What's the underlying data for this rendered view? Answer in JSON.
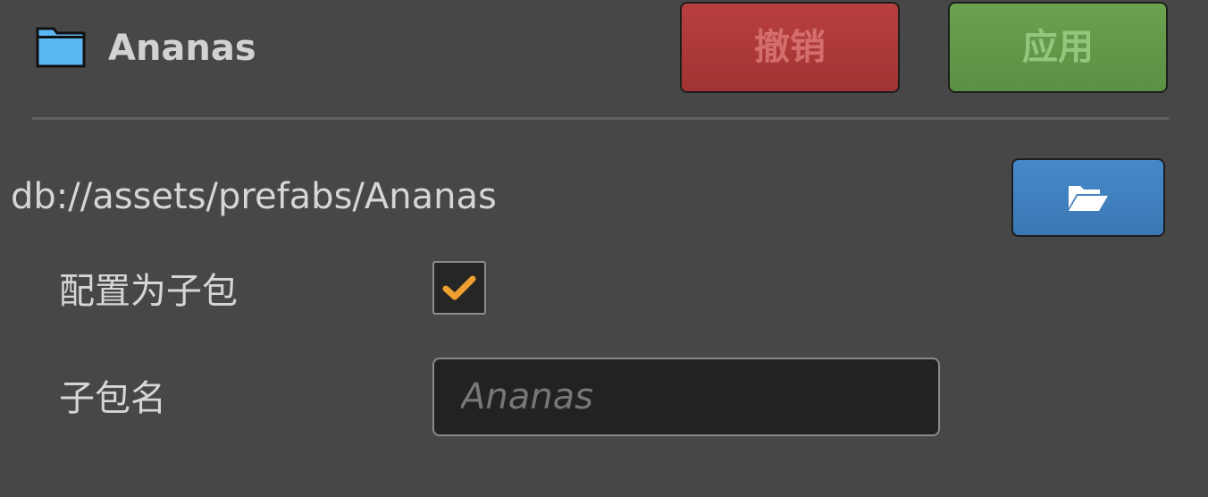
{
  "header": {
    "asset_name": "Ananas",
    "icon": "folder-icon",
    "revert_label": "撤销",
    "apply_label": "应用"
  },
  "colors": {
    "background": "#474747",
    "revert": "#a83837",
    "apply": "#5f9847",
    "browse": "#3e7fbd",
    "check": "#f0a030"
  },
  "asset": {
    "path": "db://assets/prefabs/Ananas",
    "browse_icon": "open-folder-icon"
  },
  "settings": {
    "subpackage_label": "配置为子包",
    "subpackage_checked": true,
    "subpackage_name_label": "子包名",
    "subpackage_name_value": "",
    "subpackage_name_placeholder": "Ananas"
  }
}
